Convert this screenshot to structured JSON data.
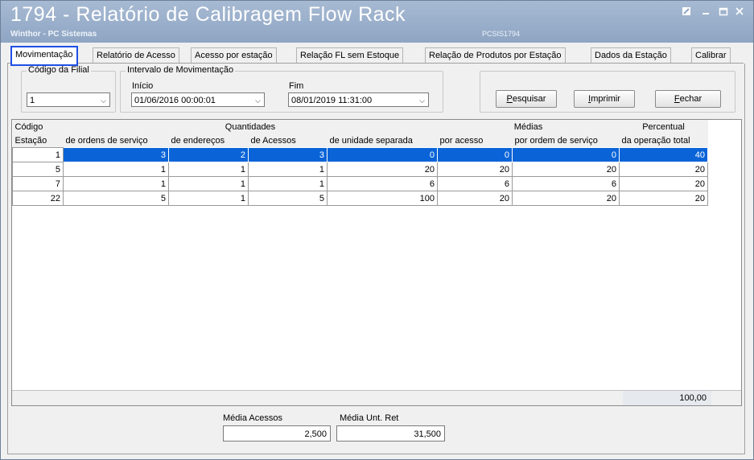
{
  "window": {
    "title": "1794 - Relatório de Calibragem Flow Rack",
    "subtitle": "Winthor - PC Sistemas",
    "system_code": "PCSIS1794",
    "controls": [
      "restore-icon",
      "minimize-icon",
      "maximize-icon",
      "close-icon"
    ]
  },
  "tabs": [
    {
      "label": "Movimentação",
      "active": true
    },
    {
      "label": "Relatório de Acesso"
    },
    {
      "label": "Acesso por estação"
    },
    {
      "label": "Relação FL sem Estoque"
    },
    {
      "label": "Relação de Produtos por Estação"
    },
    {
      "label": "Dados da Estação"
    },
    {
      "label": "Calibrar"
    }
  ],
  "filters": {
    "filial_group_label": "Código da Filial",
    "filial_value": "1",
    "interval_group_label": "Intervalo de Movimentação",
    "start_label": "Início",
    "start_value": "01/06/2016 00:00:01",
    "end_label": "Fim",
    "end_value": "08/01/2019 11:31:00"
  },
  "buttons": {
    "search": "Pesquisar",
    "print": "Imprimir",
    "close": "Fechar"
  },
  "grid": {
    "group_headers": {
      "codigo": "Código",
      "quantidades": "Quantidades",
      "medias": "Médias",
      "percentual": "Percentual"
    },
    "columns": [
      "Estação",
      "de ordens de serviço",
      "de endereços",
      "de Acessos",
      "de unidade separada",
      "por acesso",
      "por ordem de serviço",
      "da operação total"
    ],
    "rows": [
      [
        "1",
        "3",
        "2",
        "3",
        "0",
        "0",
        "0",
        "40"
      ],
      [
        "5",
        "1",
        "1",
        "1",
        "20",
        "20",
        "20",
        "20"
      ],
      [
        "7",
        "1",
        "1",
        "1",
        "6",
        "6",
        "6",
        "20"
      ],
      [
        "22",
        "5",
        "1",
        "5",
        "100",
        "20",
        "20",
        "20"
      ]
    ],
    "selected_row": 0,
    "footer_total": "100,00"
  },
  "summary": {
    "media_acessos_label": "Média Acessos",
    "media_acessos_value": "2,500",
    "media_unt_ret_label": "Média Unt. Ret",
    "media_unt_ret_value": "31,500"
  }
}
